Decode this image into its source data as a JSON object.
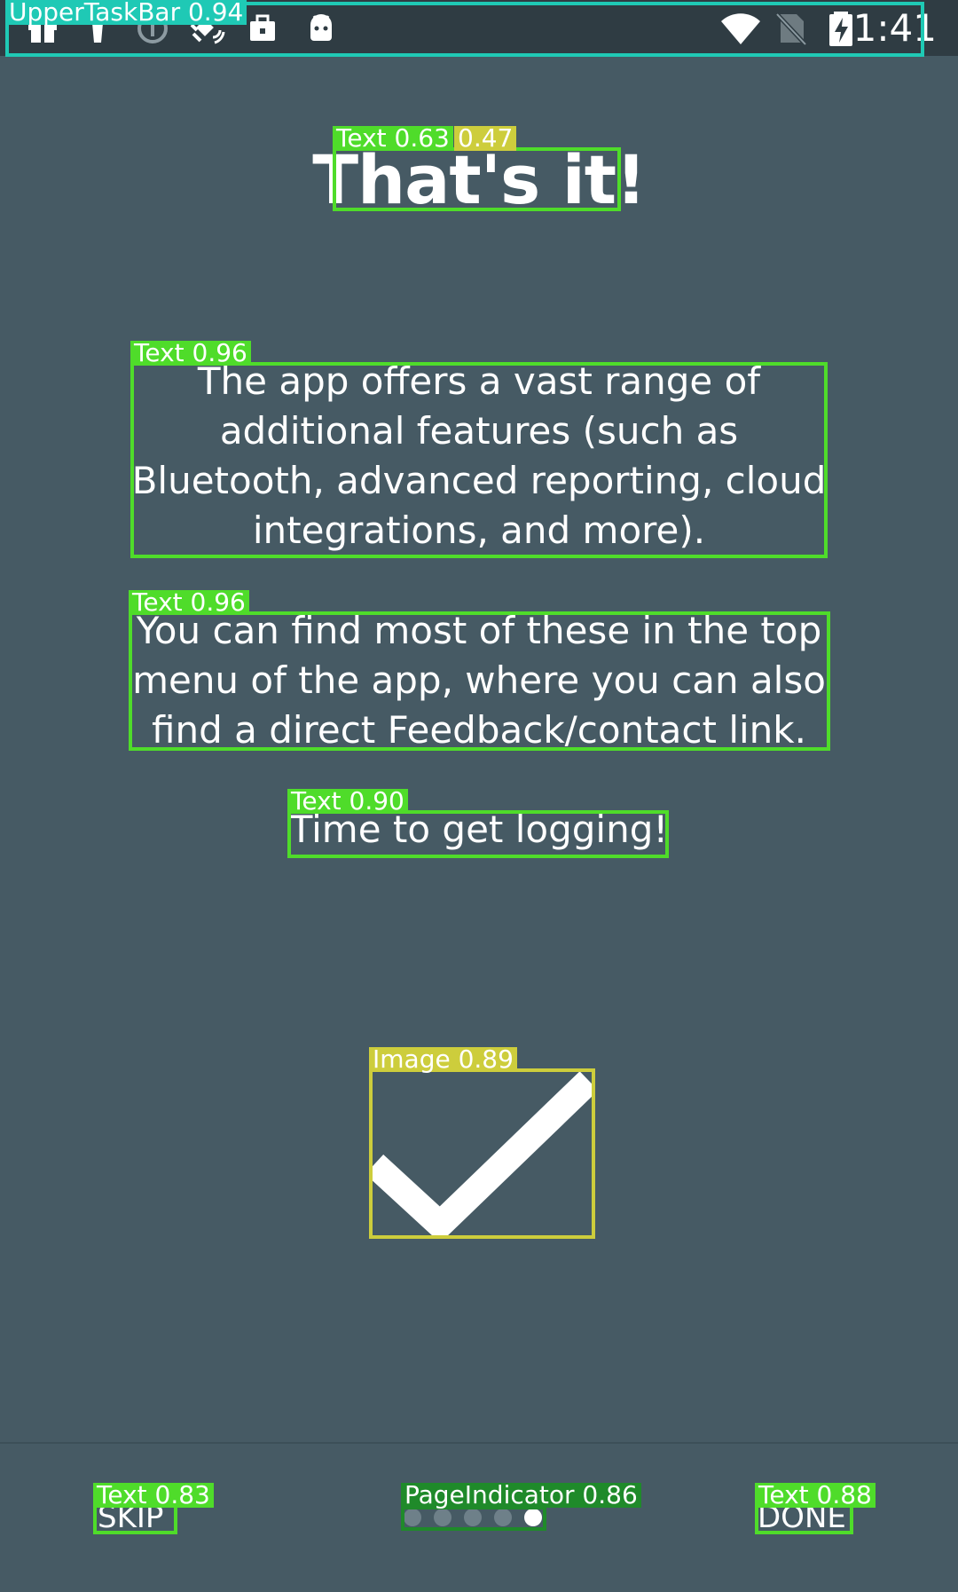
{
  "status_bar": {
    "time": "1:41",
    "left_icons": [
      "gift-icon",
      "flashlight-icon",
      "info-circle-icon",
      "satellite-icon",
      "briefcase-icon",
      "android-icon"
    ],
    "right_icons": [
      "wifi-icon",
      "no-sim-icon",
      "battery-charging-icon"
    ]
  },
  "onboarding": {
    "title": "That's it!",
    "paragraph_1": "The app offers a vast range of additional features (such as Bluetooth, advanced reporting, cloud integrations, and more).",
    "paragraph_2": "You can find most of these in the top menu of the app, where you can also find a direct Feedback/contact link.",
    "paragraph_3": "Time to get logging!",
    "image_icon": "checkmark-icon"
  },
  "navigation": {
    "skip_label": "SKIP",
    "done_label": "DONE",
    "page_count": 5,
    "current_page": 5
  },
  "annotations": {
    "status_bar": "UpperTaskBar  0.94",
    "title_tag_a": "Text  0.63",
    "title_tag_b": "0.47",
    "paragraph_1": "Text  0.96",
    "paragraph_2": "Text  0.96",
    "paragraph_3": "Text  0.90",
    "image": "Image  0.89",
    "skip": "Text  0.83",
    "page_indicator": "PageIndicator  0.86",
    "done": "Text  0.88"
  },
  "colors": {
    "background": "#465a64",
    "status_bar": "#2f3c43",
    "text": "#ffffff",
    "annotation_text": "#4fdc2a",
    "annotation_image": "#cdcd3c",
    "annotation_taskbar": "#1fc9b5"
  }
}
